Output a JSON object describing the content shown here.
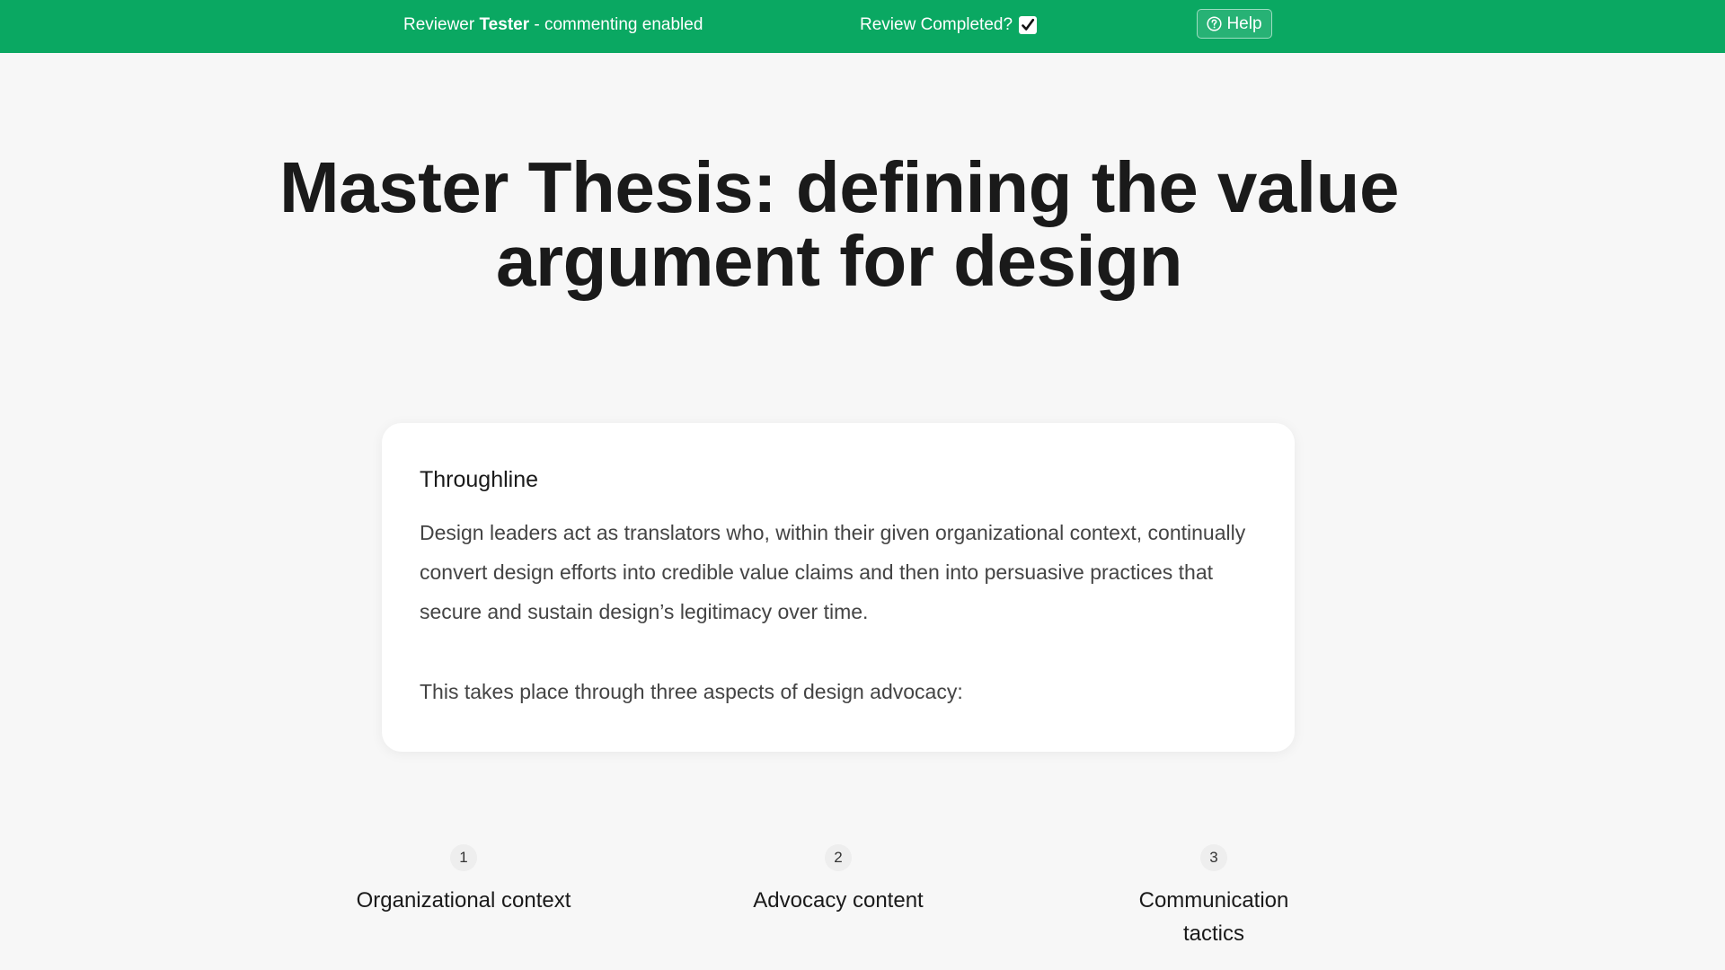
{
  "topbar": {
    "reviewer_prefix": "Reviewer ",
    "reviewer_name": "Tester",
    "reviewer_suffix": " - commenting enabled",
    "review_completed_label": "Review Completed?",
    "review_completed_checked": true,
    "help_label": "Help",
    "background_color": "#0aa862",
    "icons": {
      "checkbox": "checkmark-icon",
      "help": "question-circle-icon"
    }
  },
  "page": {
    "title": "Master Thesis: defining the value argument for design"
  },
  "throughline": {
    "heading": "Throughline",
    "body": "Design leaders act as translators who, within their given organizational context, continually convert design efforts into credible value claims and then into persuasive practices that secure and sustain design’s legitimacy over time.",
    "intro": "This takes place through three aspects of design advocacy:"
  },
  "aspects": [
    {
      "number": "1",
      "label": "Organizational context"
    },
    {
      "number": "2",
      "label": "Advocacy content"
    },
    {
      "number": "3",
      "label": "Communication tactics"
    }
  ]
}
